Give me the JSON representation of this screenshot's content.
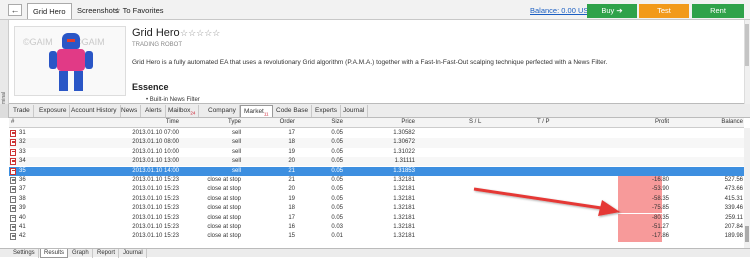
{
  "market": {
    "back_label": "🡐",
    "tabs": [
      "Grid Hero",
      "Screenshots"
    ],
    "favorites_label": "To Favorites",
    "balance_label": "Balance: 0.00 USD",
    "buy_label": "Buy",
    "test_label": "Test",
    "rent_label": "Rent",
    "product_title": "Grid Hero",
    "rating_stars": "☆☆☆☆☆",
    "product_subtitle": "TRADING ROBOT",
    "description": "Grid Hero is a fully automated EA that uses a revolutionary Grid algorithm (P.A.M.A.) together with a Fast-In-Fast-Out scalping technique perfected with a News Filter.",
    "essence_heading": "Essence",
    "essence_bullet": "Built-in News Filter",
    "strip_label": "Terminal",
    "watermark": "©GAIM",
    "colors": {
      "buy": "#2fa24a",
      "test": "#f29a1a",
      "rent": "#2fa24a",
      "link": "#1a5ec2"
    }
  },
  "terminal_tabs": [
    {
      "label": "Trade"
    },
    {
      "label": "Exposure"
    },
    {
      "label": "Account History"
    },
    {
      "label": "News"
    },
    {
      "label": "Alerts"
    },
    {
      "label": "Mailbox",
      "badge": "24"
    },
    {
      "label": "Company"
    },
    {
      "label": "Market",
      "badge": "11"
    },
    {
      "label": "Code Base"
    },
    {
      "label": "Experts"
    },
    {
      "label": "Journal"
    }
  ],
  "results": {
    "columns": [
      "#",
      "Time",
      "Type",
      "Order",
      "Size",
      "Price",
      "S / L",
      "T / P",
      "Profit",
      "Balance"
    ],
    "rows": [
      {
        "n": "31",
        "time": "2013.01.10 07:00",
        "type": "sell",
        "order": "17",
        "size": "0.05",
        "price": "1.30582",
        "sl": "",
        "tp": "",
        "profit": "",
        "balance": ""
      },
      {
        "n": "32",
        "time": "2013.01.10 08:00",
        "type": "sell",
        "order": "18",
        "size": "0.05",
        "price": "1.30672",
        "sl": "",
        "tp": "",
        "profit": "",
        "balance": ""
      },
      {
        "n": "33",
        "time": "2013.01.10 10:00",
        "type": "sell",
        "order": "19",
        "size": "0.05",
        "price": "1.31022",
        "sl": "",
        "tp": "",
        "profit": "",
        "balance": ""
      },
      {
        "n": "34",
        "time": "2013.01.10 13:00",
        "type": "sell",
        "order": "20",
        "size": "0.05",
        "price": "1.31111",
        "sl": "",
        "tp": "",
        "profit": "",
        "balance": ""
      },
      {
        "n": "35",
        "time": "2013.01.10 14:00",
        "type": "sell",
        "order": "21",
        "size": "0.05",
        "price": "1.31853",
        "sl": "",
        "tp": "",
        "profit": "",
        "balance": ""
      },
      {
        "n": "36",
        "time": "2013.01.10 15:23",
        "type": "close at stop",
        "order": "21",
        "size": "0.05",
        "price": "1.32181",
        "sl": "",
        "tp": "",
        "profit": "-16.80",
        "balance": "527.56"
      },
      {
        "n": "37",
        "time": "2013.01.10 15:23",
        "type": "close at stop",
        "order": "20",
        "size": "0.05",
        "price": "1.32181",
        "sl": "",
        "tp": "",
        "profit": "-53.90",
        "balance": "473.66"
      },
      {
        "n": "38",
        "time": "2013.01.10 15:23",
        "type": "close at stop",
        "order": "19",
        "size": "0.05",
        "price": "1.32181",
        "sl": "",
        "tp": "",
        "profit": "-58.35",
        "balance": "415.31"
      },
      {
        "n": "39",
        "time": "2013.01.10 15:23",
        "type": "close at stop",
        "order": "18",
        "size": "0.05",
        "price": "1.32181",
        "sl": "",
        "tp": "",
        "profit": "-75.85",
        "balance": "339.46"
      },
      {
        "n": "40",
        "time": "2013.01.10 15:23",
        "type": "close at stop",
        "order": "17",
        "size": "0.05",
        "price": "1.32181",
        "sl": "",
        "tp": "",
        "profit": "-80.35",
        "balance": "259.11"
      },
      {
        "n": "41",
        "time": "2013.01.10 15:23",
        "type": "close at stop",
        "order": "16",
        "size": "0.03",
        "price": "1.32181",
        "sl": "",
        "tp": "",
        "profit": "-51.27",
        "balance": "207.84"
      },
      {
        "n": "42",
        "time": "2013.01.10 15:23",
        "type": "close at stop",
        "order": "15",
        "size": "0.01",
        "price": "1.32181",
        "sl": "",
        "tp": "",
        "profit": "-17.86",
        "balance": "189.98"
      }
    ],
    "selected_row": "35",
    "highlight_color": "#f79a9a",
    "selected_color": "#3d8fe0"
  },
  "bottom_tabs": [
    {
      "label": "Settings"
    },
    {
      "label": "Results"
    },
    {
      "label": "Graph"
    },
    {
      "label": "Report"
    },
    {
      "label": "Journal"
    }
  ],
  "icons": {
    "back": "arrow-left-icon",
    "favorite": "star-icon",
    "buy_arrow": "arrow-right-icon",
    "row_sell": "sell-order-icon",
    "row_close": "close-order-icon"
  }
}
